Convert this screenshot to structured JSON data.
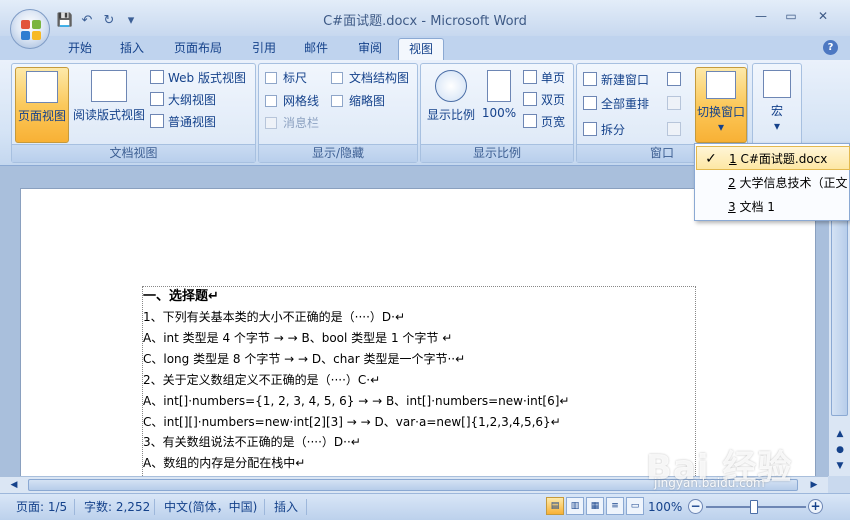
{
  "window": {
    "title": "C#面试题.docx - Microsoft Word",
    "minimize": "—",
    "restore": "▭",
    "close": "✕"
  },
  "qat": {
    "save": "💾",
    "undo": "↶",
    "redo": "↻",
    "more": "▾"
  },
  "tabs": [
    "开始",
    "插入",
    "页面布局",
    "引用",
    "邮件",
    "审阅",
    "视图"
  ],
  "active_tab": "视图",
  "help": "?",
  "groups": {
    "doc_views": {
      "label": "文档视图",
      "print_layout": "页面视图",
      "reading_layout": "阅读版式视图",
      "web_layout": "Web 版式视图",
      "outline": "大纲视图",
      "draft": "普通视图"
    },
    "show_hide": {
      "label": "显示/隐藏",
      "ruler": "标尺",
      "document_map": "文档结构图",
      "gridlines": "网格线",
      "thumbnails": "缩略图",
      "message_bar": "消息栏"
    },
    "zoom": {
      "label": "显示比例",
      "zoom": "显示比例",
      "hundred": "100%",
      "one_page": "单页",
      "two_pages": "双页",
      "page_width": "页宽"
    },
    "window": {
      "label": "窗口",
      "new_window": "新建窗口",
      "arrange_all": "全部重排",
      "split": "拆分",
      "switch_windows": "切换窗口",
      "switch_arrow": "▾"
    },
    "macros": {
      "label": "宏",
      "macros": "宏",
      "arrow": "▾"
    }
  },
  "switch_menu": {
    "items": [
      {
        "num": "1",
        "text": " C#面试题.docx",
        "checked": "✓"
      },
      {
        "num": "2",
        "text": " 大学信息技术（正文",
        "checked": ""
      },
      {
        "num": "3",
        "text": " 文档 1",
        "checked": ""
      }
    ]
  },
  "document": {
    "lines": [
      "一、选择题↵",
      "1、下列有关基本类的大小不正确的是（····）D·↵",
      " A、int 类型是 4 个字节 →  →  B、bool 类型是 1 个字节 ↵",
      " C、long 类型是 8 个字节 →  →  D、char 类型是一个字节··↵",
      "2、关于定义数组定义不正确的是（····）C·↵",
      " A、int[]·numbers={1, 2, 3, 4, 5, 6} →  →  B、int[]·numbers=new·int[6]↵",
      " C、int[][]·numbers=new·int[2][3] →  →  D、var·a=new[]{1,2,3,4,5,6}↵",
      "3、有关数组说法不正确的是（····）D··↵",
      " A、数组的内存是分配在栈中↵"
    ]
  },
  "status": {
    "page": "页面: 1/5",
    "words": "字数: 2,252",
    "language": "中文(简体，中国)",
    "insert": "插入",
    "zoom": "100%",
    "zoom_minus": "−",
    "zoom_plus": "+"
  },
  "watermark": {
    "main": "Bai 经验",
    "sub": "jingyan.baidu.com"
  },
  "colors": {
    "accent": "#15428b",
    "active_button": "#fbc95c",
    "ribbon_bg": "#d4e3f5"
  }
}
